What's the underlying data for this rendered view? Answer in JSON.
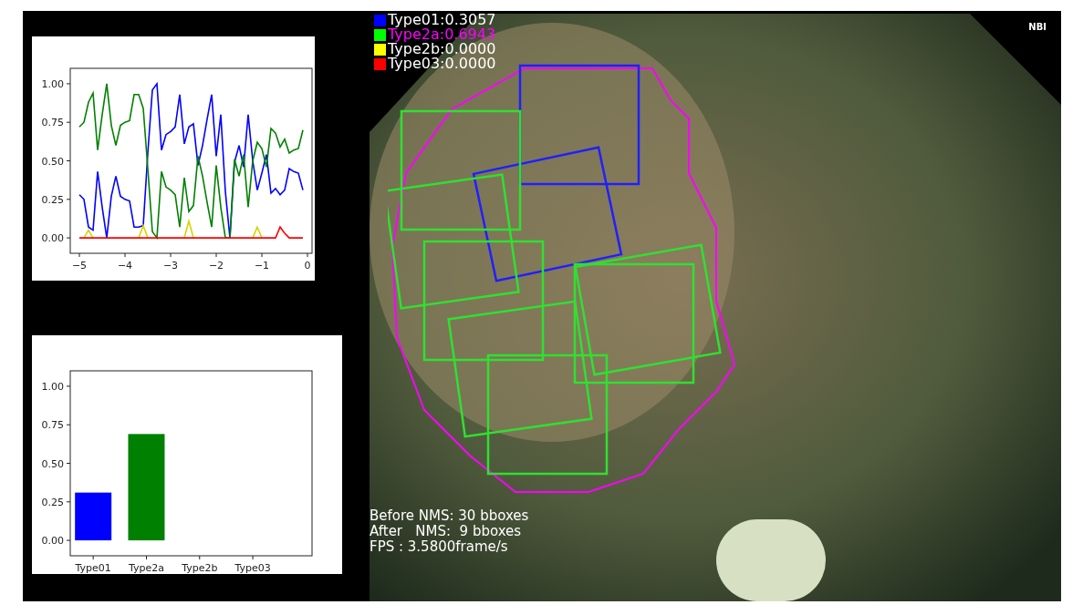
{
  "trend_chart": {
    "chart_data": {
      "type": "line",
      "xlim": [
        -5.2,
        0.1
      ],
      "ylim": [
        -0.1,
        1.1
      ],
      "xticks": [
        -5,
        -4,
        -3,
        -2,
        -1,
        0
      ],
      "yticks": [
        {
          "value": 0,
          "label": "0.00"
        },
        {
          "value": 0.25,
          "label": "0.25"
        },
        {
          "value": 0.5,
          "label": "0.50"
        },
        {
          "value": 0.75,
          "label": "0.75"
        },
        {
          "value": 1,
          "label": "1.00"
        }
      ],
      "x": [
        -5,
        -4.9,
        -4.8,
        -4.7,
        -4.6,
        -4.5,
        -4.4,
        -4.3,
        -4.2,
        -4.1,
        -4,
        -3.9,
        -3.8,
        -3.7,
        -3.6,
        -3.5,
        -3.4,
        -3.3,
        -3.2,
        -3.1,
        -3,
        -2.9,
        -2.8,
        -2.7,
        -2.6,
        -2.5,
        -2.4,
        -2.3,
        -2.2,
        -2.1,
        -2,
        -1.9,
        -1.8,
        -1.7,
        -1.6,
        -1.5,
        -1.4,
        -1.3,
        -1.2,
        -1.1,
        -1,
        -0.9,
        -0.8,
        -0.7,
        -0.6,
        -0.5,
        -0.4,
        -0.3,
        -0.2,
        -0.1
      ],
      "series": [
        {
          "color": "#0000ff",
          "values": [
            0.28,
            0.25,
            0.07,
            0.05,
            0.43,
            0.2,
            0,
            0.27,
            0.4,
            0.27,
            0.25,
            0.24,
            0.07,
            0.07,
            0.08,
            0.55,
            0.96,
            1,
            0.57,
            0.67,
            0.69,
            0.72,
            0.93,
            0.61,
            0.72,
            0.74,
            0.47,
            0.6,
            0.77,
            0.93,
            0.53,
            0.8,
            0.3,
            0,
            0.49,
            0.6,
            0.46,
            0.8,
            0.5,
            0.31,
            0.42,
            0.54,
            0.29,
            0.32,
            0.28,
            0.31,
            0.45,
            0.43,
            0.42,
            0.31
          ]
        },
        {
          "color": "#008000",
          "values": [
            0.72,
            0.75,
            0.88,
            0.94,
            0.57,
            0.8,
            1,
            0.73,
            0.6,
            0.73,
            0.75,
            0.76,
            0.93,
            0.93,
            0.84,
            0.45,
            0.04,
            0,
            0.43,
            0.33,
            0.31,
            0.28,
            0.07,
            0.39,
            0.17,
            0.21,
            0.53,
            0.4,
            0.23,
            0.07,
            0.47,
            0.2,
            0,
            0,
            0.51,
            0.4,
            0.54,
            0.2,
            0.5,
            0.62,
            0.58,
            0.46,
            0.71,
            0.68,
            0.59,
            0.64,
            0.55,
            0.57,
            0.58,
            0.7
          ]
        },
        {
          "color": "#d4d400",
          "values": [
            null,
            0,
            0.05,
            0,
            null,
            null,
            null,
            null,
            null,
            null,
            null,
            null,
            null,
            0,
            0.08,
            0,
            null,
            null,
            null,
            null,
            null,
            null,
            null,
            0,
            0.11,
            0,
            null,
            null,
            null,
            null,
            null,
            null,
            null,
            null,
            null,
            null,
            null,
            null,
            0,
            0.07,
            0,
            null,
            null,
            null,
            null,
            null,
            null,
            null,
            null,
            null
          ]
        },
        {
          "color": "#ff0000",
          "values": [
            0,
            0,
            0,
            0,
            0,
            0,
            0,
            0,
            0,
            0,
            0,
            0,
            0,
            0,
            0,
            0,
            0,
            0,
            0,
            0,
            0,
            0,
            0,
            0,
            0,
            0,
            0,
            0,
            0,
            0,
            0,
            0,
            0,
            0,
            0,
            0,
            0,
            0,
            0,
            0,
            0,
            0,
            0,
            0,
            0.07,
            0.03,
            0,
            0,
            0,
            0
          ]
        }
      ]
    }
  },
  "probability_chart": {
    "chart_data": {
      "type": "bar",
      "categories": [
        "Type01",
        "Type2a",
        "Type2b",
        "Type03"
      ],
      "ylim": [
        -0.1,
        1.1
      ],
      "yticks": [
        {
          "value": 0,
          "label": "0.00"
        },
        {
          "value": 0.25,
          "label": "0.25"
        },
        {
          "value": 0.5,
          "label": "0.50"
        },
        {
          "value": 0.75,
          "label": "0.75"
        },
        {
          "value": 1,
          "label": "1.00"
        }
      ],
      "series": [
        {
          "color": "#0000ff",
          "values": [
            0.31,
            null,
            null,
            null
          ]
        },
        {
          "color": "#008000",
          "values": [
            null,
            0.69,
            null,
            null
          ]
        }
      ]
    }
  },
  "legend": [
    {
      "label": "Type01:0.3057",
      "color": "#0000ff",
      "highlighted": false
    },
    {
      "label": "Type2a:0.6943",
      "color": "#00ff00",
      "highlighted": true
    },
    {
      "label": "Type2b:0.0000",
      "color": "#ffff00",
      "highlighted": false
    },
    {
      "label": "Type03:0.0000",
      "color": "#ff0000",
      "highlighted": false
    }
  ],
  "mode_label": "NBI",
  "stats": [
    "Before NMS: 30 bboxes",
    "After   NMS:  9 bboxes",
    "FPS : 3.5800frame/s"
  ]
}
